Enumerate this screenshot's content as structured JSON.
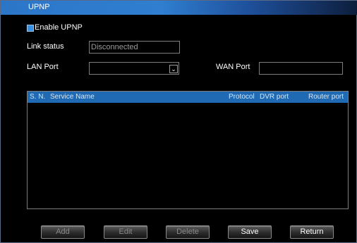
{
  "window": {
    "title": "UPNP"
  },
  "enable": {
    "label": "Enable UPNP",
    "checked": true
  },
  "link_status": {
    "label": "Link status",
    "value": "Disconnected"
  },
  "lan_port": {
    "label": "LAN Port",
    "value": ""
  },
  "wan_port": {
    "label": "WAN Port",
    "value": ""
  },
  "table": {
    "columns": [
      "S. N.",
      "Service Name",
      "Protocol",
      "DVR port",
      "Router port"
    ],
    "rows": []
  },
  "buttons": {
    "add": "Add",
    "edit": "Edit",
    "delete": "Delete",
    "save": "Save",
    "return": "Return"
  },
  "colors": {
    "accent": "#1f6ab3",
    "checkbox": "#3b8fe0"
  }
}
